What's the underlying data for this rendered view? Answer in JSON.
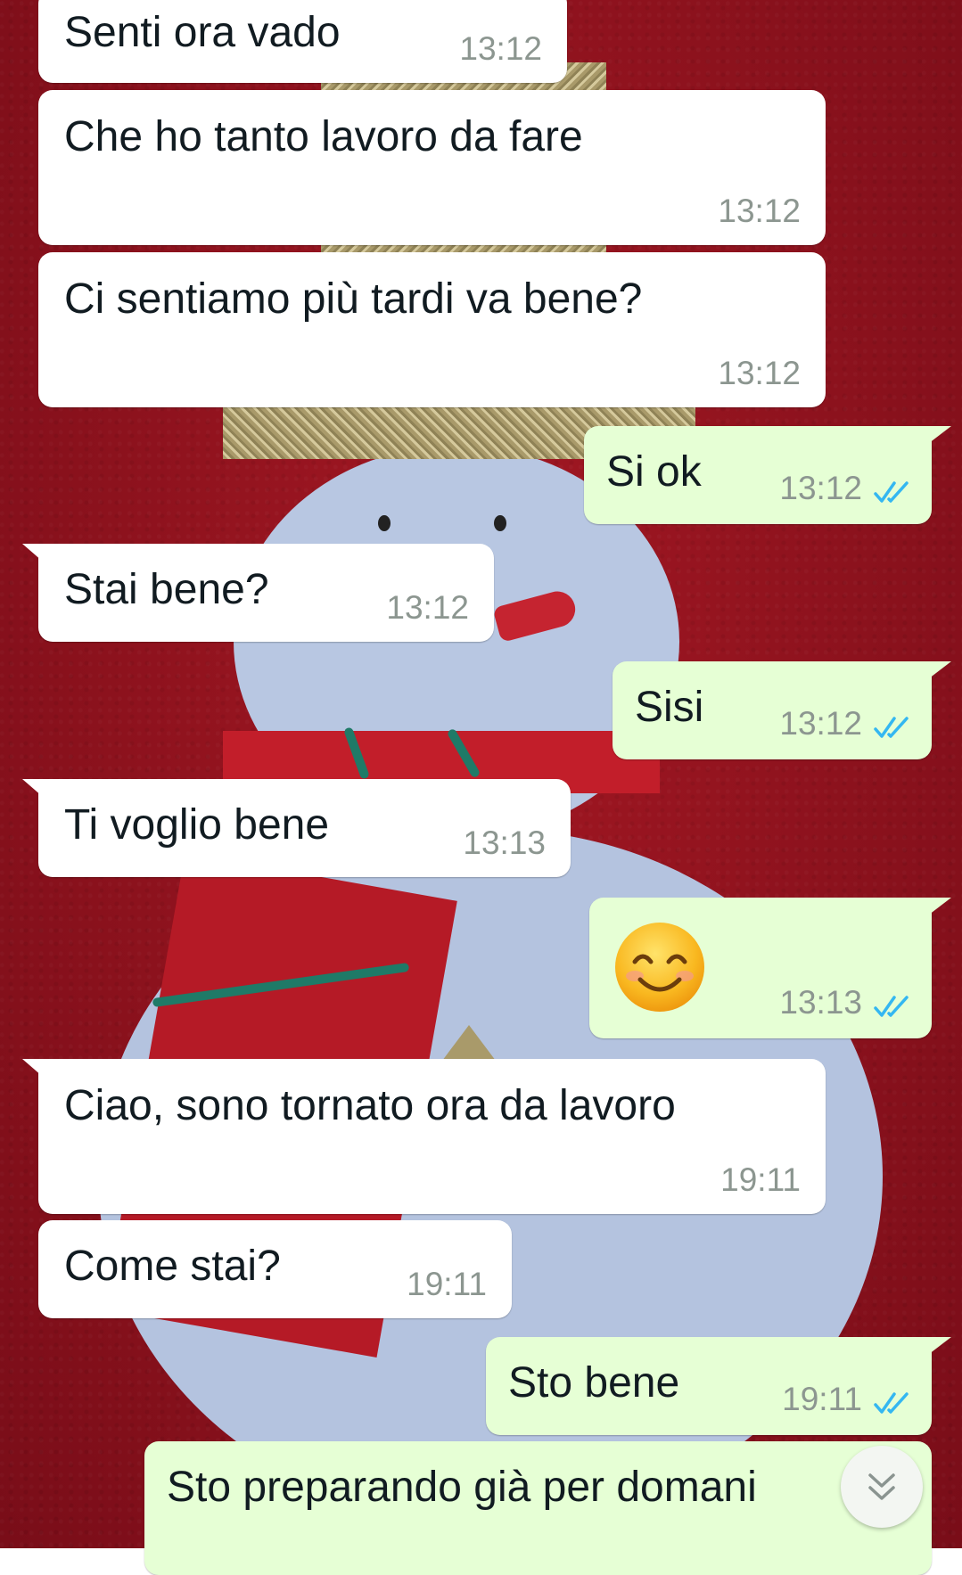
{
  "messages": [
    {
      "direction": "incoming",
      "text": "Senti ora vado",
      "time": "13:12"
    },
    {
      "direction": "incoming",
      "text": "Che ho tanto lavoro da fare",
      "time": "13:12"
    },
    {
      "direction": "incoming",
      "text": "Ci sentiamo più tardi va bene?",
      "time": "13:12"
    },
    {
      "direction": "outgoing",
      "text": "Si ok",
      "time": "13:12",
      "status": "read"
    },
    {
      "direction": "incoming",
      "text": "Stai bene?",
      "time": "13:12"
    },
    {
      "direction": "outgoing",
      "text": "Sisi",
      "time": "13:12",
      "status": "read"
    },
    {
      "direction": "incoming",
      "text": "Ti voglio bene",
      "time": "13:13"
    },
    {
      "direction": "outgoing",
      "emoji": "smiling-face-with-smiling-eyes",
      "time": "13:13",
      "status": "read"
    },
    {
      "direction": "incoming",
      "text": "Ciao, sono tornato ora da lavoro",
      "time": "19:11"
    },
    {
      "direction": "incoming",
      "text": "Come stai?",
      "time": "19:11"
    },
    {
      "direction": "outgoing",
      "text": "Sto bene",
      "time": "19:11",
      "status": "read"
    },
    {
      "direction": "outgoing",
      "text": "Sto preparando già per domani"
    }
  ],
  "colors": {
    "incoming_bubble": "#ffffff",
    "outgoing_bubble": "#e6ffd5",
    "read_ticks": "#34b7f1",
    "timestamp": "#8c9690"
  },
  "icons": {
    "read_receipt": "double-check-icon",
    "scroll_down": "double-chevron-down-icon"
  }
}
